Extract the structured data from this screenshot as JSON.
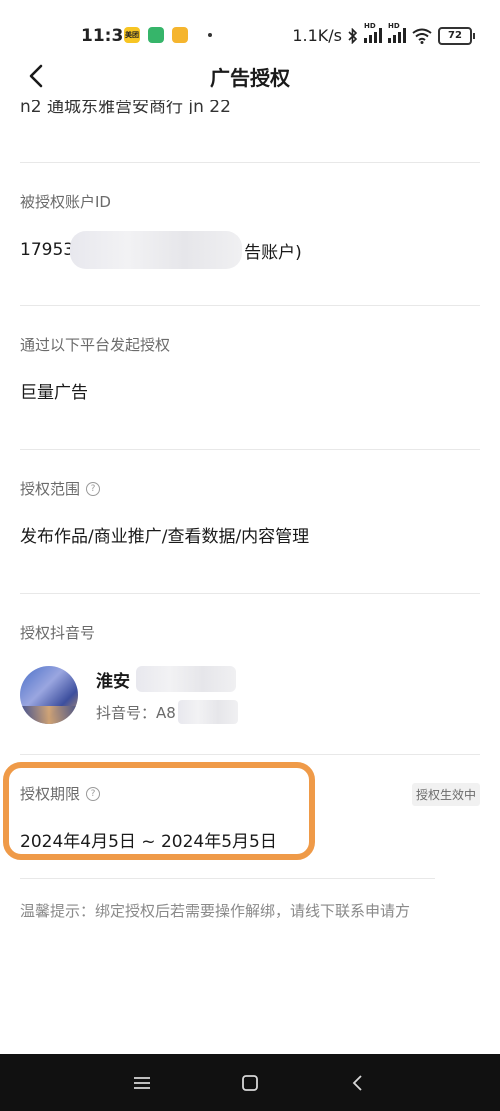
{
  "status_bar": {
    "time": "11:35",
    "meituan_icon_text": "美团",
    "net_speed": "1.1K/s",
    "signal1_label": "HD",
    "signal2_label": "HD",
    "battery": "72"
  },
  "header": {
    "title": "广告授权",
    "back_icon": "chevron-left-icon"
  },
  "top_partial_text": "n2 通城东雅营安商行 jn 22",
  "sections": {
    "account": {
      "label": "被授权账户ID",
      "value_prefix": "17953",
      "value_suffix": "告账户)"
    },
    "platform": {
      "label": "通过以下平台发起授权",
      "value": "巨量广告"
    },
    "scope": {
      "label": "授权范围",
      "value": "发布作品/商业推广/查看数据/内容管理"
    },
    "douyin": {
      "label": "授权抖音号",
      "name_visible": "淮安",
      "id_prefix": "抖音号：A8"
    },
    "period": {
      "label": "授权期限",
      "value": "2024年4月5日 ~ 2024年5月5日",
      "status": "授权生效中",
      "highlight_color": "#ef9a48"
    }
  },
  "tip": "温馨提示：绑定授权后若需要操作解绑，请线下联系申请方",
  "system_nav": {
    "menu_icon": "menu-icon",
    "home_icon": "home-square-icon",
    "back_icon": "back-triangle-icon"
  }
}
